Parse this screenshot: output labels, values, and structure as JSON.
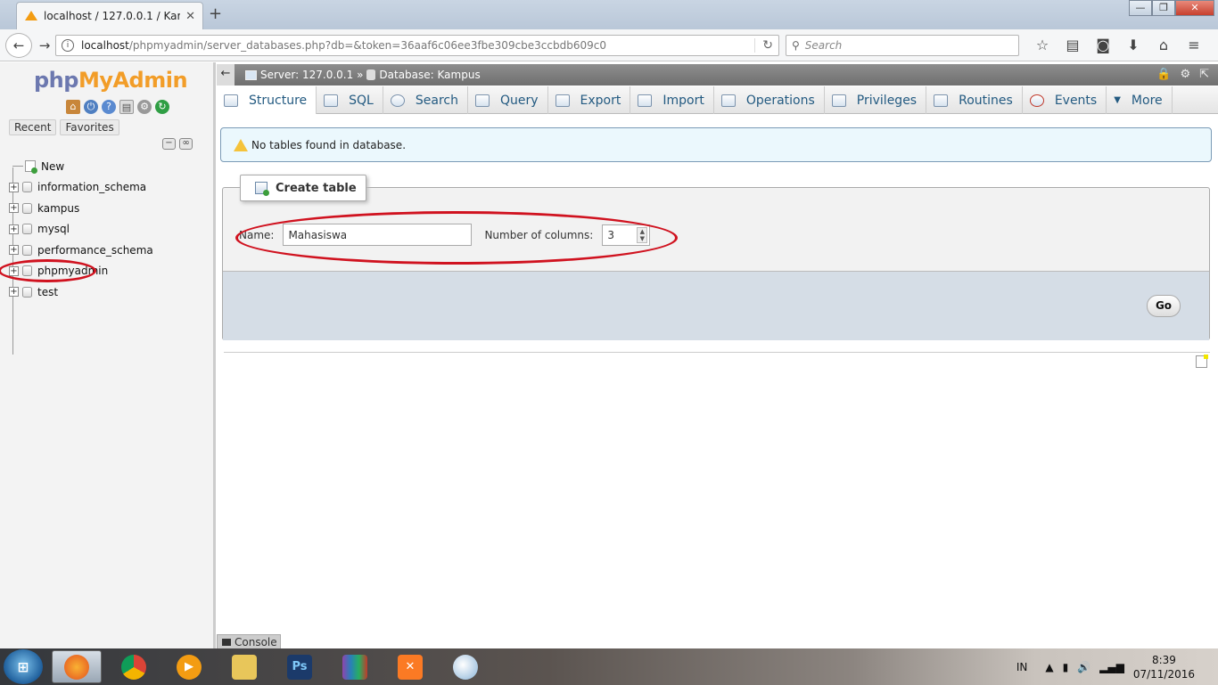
{
  "browser": {
    "tab_title": "localhost / 127.0.0.1 / Kam...",
    "tab_close": "✕",
    "new_tab": "+",
    "url_host": "localhost",
    "url_path": "/phpmyadmin/server_databases.php?db=&token=36aaf6c06ee3fbe309cbe3ccbdb609c0",
    "search_placeholder": "Search",
    "window_controls": [
      "—",
      "❐",
      "✕"
    ]
  },
  "pma": {
    "logo_php": "php",
    "logo_my": "My",
    "logo_admin": "Admin",
    "recent_label": "Recent",
    "favorites_label": "Favorites",
    "tree": [
      {
        "label": "New",
        "type": "new"
      },
      {
        "label": "information_schema",
        "type": "db"
      },
      {
        "label": "kampus",
        "type": "db"
      },
      {
        "label": "mysql",
        "type": "db"
      },
      {
        "label": "performance_schema",
        "type": "db"
      },
      {
        "label": "phpmyadmin",
        "type": "db"
      },
      {
        "label": "test",
        "type": "db"
      }
    ]
  },
  "breadcrumb": {
    "server": "Server: 127.0.0.1 »",
    "database": "Database: Kampus"
  },
  "tabs": [
    {
      "label": "Structure",
      "active": true
    },
    {
      "label": "SQL"
    },
    {
      "label": "Search"
    },
    {
      "label": "Query"
    },
    {
      "label": "Export"
    },
    {
      "label": "Import"
    },
    {
      "label": "Operations"
    },
    {
      "label": "Privileges"
    },
    {
      "label": "Routines"
    },
    {
      "label": "Events"
    },
    {
      "label": "More"
    }
  ],
  "notice": "No tables found in database.",
  "create_table": {
    "legend": "Create table",
    "name_label": "Name:",
    "name_value": "Mahasiswa",
    "columns_label": "Number of columns:",
    "columns_value": "3",
    "go_label": "Go"
  },
  "console_label": "Console",
  "taskbar": {
    "lang": "IN",
    "time": "8:39",
    "date": "07/11/2016",
    "apps": [
      "firefox",
      "chrome",
      "media-player",
      "file-explorer",
      "photoshop",
      "winrar",
      "xampp",
      "paint"
    ]
  },
  "colors": {
    "annotation_red": "#d0121f",
    "tab_text": "#235a81",
    "notice_bg": "#ebf8fd"
  }
}
